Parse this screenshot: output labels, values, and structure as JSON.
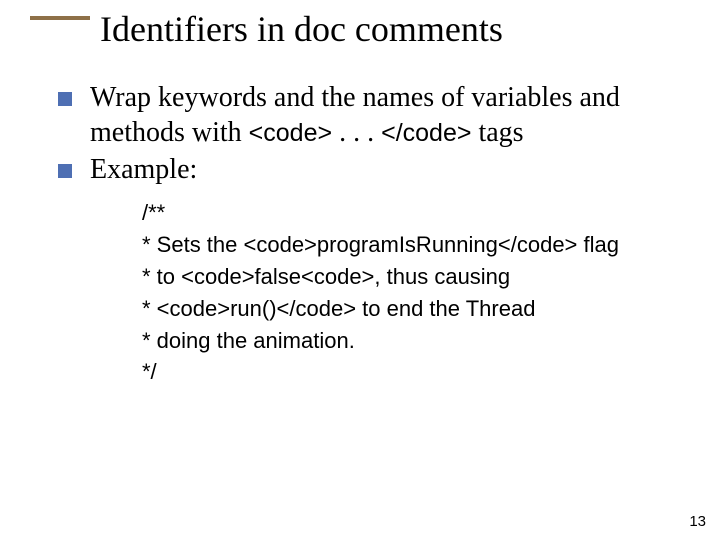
{
  "title": "Identifiers in doc comments",
  "bullets": {
    "b1_pre": "Wrap keywords and the names of variables and methods with ",
    "b1_code1": "<code>",
    "b1_mid": " . . . ",
    "b1_code2": "</code>",
    "b1_post": " tags",
    "b2": "Example:"
  },
  "example": {
    "l1": "/**",
    "l2": " * Sets the <code>programIsRunning</code> flag",
    "l3": " * to <code>false<code>, thus causing",
    "l4": " * <code>run()</code> to end the Thread",
    "l5": " * doing the animation.",
    "l6": " */"
  },
  "page": "13"
}
